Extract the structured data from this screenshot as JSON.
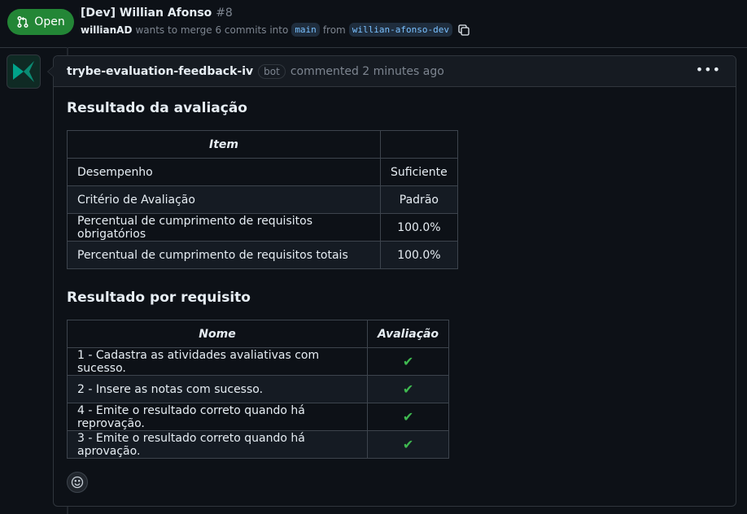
{
  "header": {
    "status": "Open",
    "title": "[Dev] Willian Afonso",
    "number": "#8",
    "author": "willianAD",
    "merge_text": "wants to merge 6 commits into",
    "base_branch": "main",
    "from_text": "from",
    "head_branch": "willian-afonso-dev"
  },
  "comment": {
    "author": "trybe-evaluation-feedback-iv",
    "badge": "bot",
    "meta": "commented 2 minutes ago",
    "section1_title": "Resultado da avaliação",
    "table1": {
      "headers": [
        "Item",
        ""
      ],
      "rows": [
        [
          "Desempenho",
          "Suficiente"
        ],
        [
          "Critério de Avaliação",
          "Padrão"
        ],
        [
          "Percentual de cumprimento de requisitos obrigatórios",
          "100.0%"
        ],
        [
          "Percentual de cumprimento de requisitos totais",
          "100.0%"
        ]
      ]
    },
    "section2_title": "Resultado por requisito",
    "table2": {
      "headers": [
        "Nome",
        "Avaliação"
      ],
      "rows": [
        [
          "1 - Cadastra as atividades avaliativas com sucesso.",
          "✔"
        ],
        [
          "2 - Insere as notas com sucesso.",
          "✔"
        ],
        [
          "4 - Emite o resultado correto quando há reprovação.",
          "✔"
        ],
        [
          "3 - Emite o resultado correto quando há aprovação.",
          "✔"
        ]
      ]
    }
  },
  "icons": {
    "status": "git-pull-request-icon",
    "copy": "copy-icon",
    "menu": "kebab-horizontal-icon",
    "reaction": "smiley-icon",
    "avatar": "trybe-logo"
  },
  "colors": {
    "open": "#238636",
    "check": "#3fb950",
    "avatar_bg": "#0f2a24"
  }
}
